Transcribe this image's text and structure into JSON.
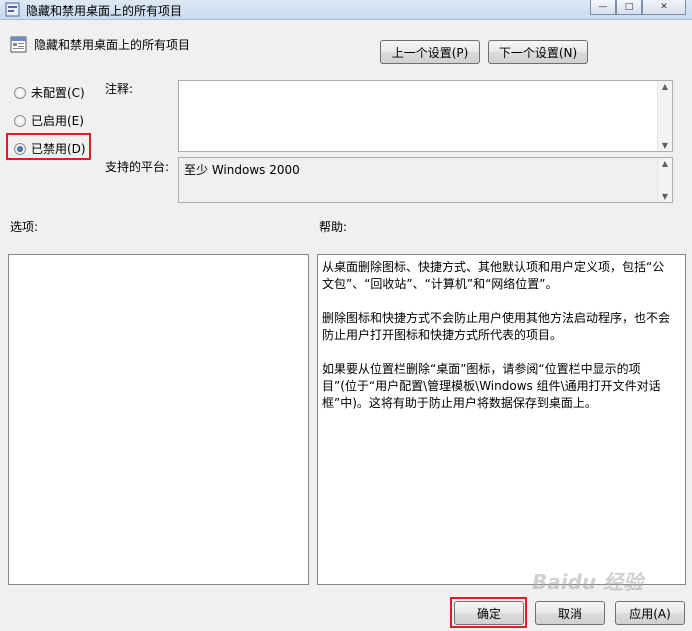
{
  "window": {
    "title": "隐藏和禁用桌面上的所有项目",
    "min_glyph": "—",
    "max_glyph": "□",
    "close_glyph": "✕"
  },
  "header": {
    "policy_name": "隐藏和禁用桌面上的所有项目",
    "prev_label": "上一个设置(P)",
    "next_label": "下一个设置(N)"
  },
  "state": {
    "options": [
      {
        "label": "未配置(C)",
        "checked": false
      },
      {
        "label": "已启用(E)",
        "checked": false
      },
      {
        "label": "已禁用(D)",
        "checked": true
      }
    ]
  },
  "comment": {
    "label": "注释:",
    "value": ""
  },
  "platform": {
    "label": "支持的平台:",
    "value": "至少 Windows 2000"
  },
  "options_section": {
    "label": "选项:"
  },
  "help": {
    "label": "帮助:",
    "paragraphs": [
      "从桌面删除图标、快捷方式、其他默认项和用户定义项，包括“公文包”、“回收站”、“计算机”和“网络位置”。",
      "删除图标和快捷方式不会防止用户使用其他方法启动程序，也不会防止用户打开图标和快捷方式所代表的项目。",
      "如果要从位置栏删除“桌面”图标，请参阅“位置栏中显示的项目”(位于“用户配置\\管理模板\\Windows 组件\\通用打开文件对话框”中)。这将有助于防止用户将数据保存到桌面上。"
    ]
  },
  "footer": {
    "ok_label": "确定",
    "cancel_label": "取消",
    "apply_label": "应用(A)"
  },
  "watermark": "Baidu 经验",
  "colors": {
    "highlight_box": "#d9202a"
  }
}
